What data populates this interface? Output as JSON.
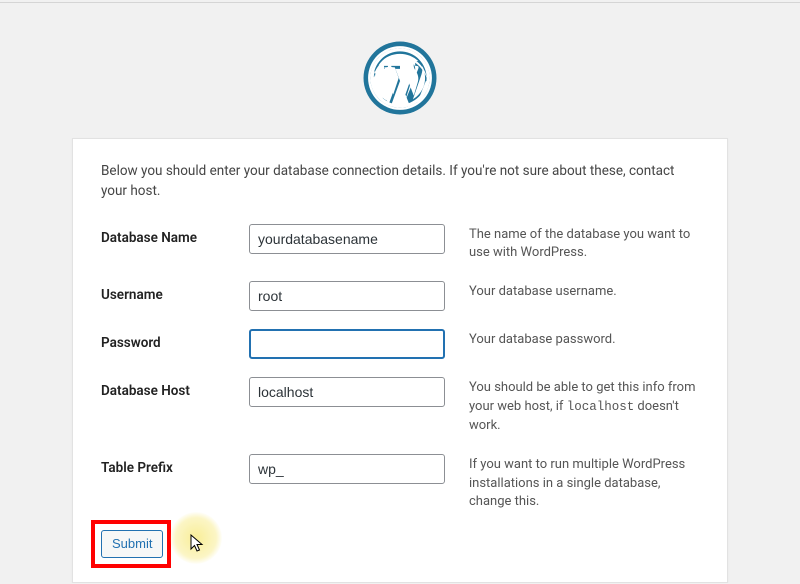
{
  "intro": "Below you should enter your database connection details. If you're not sure about these, contact your host.",
  "fields": {
    "dbname": {
      "label": "Database Name",
      "value": "yourdatabasename",
      "desc": "The name of the database you want to use with WordPress."
    },
    "uname": {
      "label": "Username",
      "value": "root",
      "desc": "Your database username."
    },
    "pwd": {
      "label": "Password",
      "value": "",
      "desc": "Your database password."
    },
    "dbhost": {
      "label": "Database Host",
      "value": "localhost",
      "desc_pre": "You should be able to get this info from your web host, if ",
      "desc_code": "localhost",
      "desc_post": " doesn't work."
    },
    "prefix": {
      "label": "Table Prefix",
      "value": "wp_",
      "desc": "If you want to run multiple WordPress installations in a single database, change this."
    }
  },
  "submit_label": "Submit"
}
